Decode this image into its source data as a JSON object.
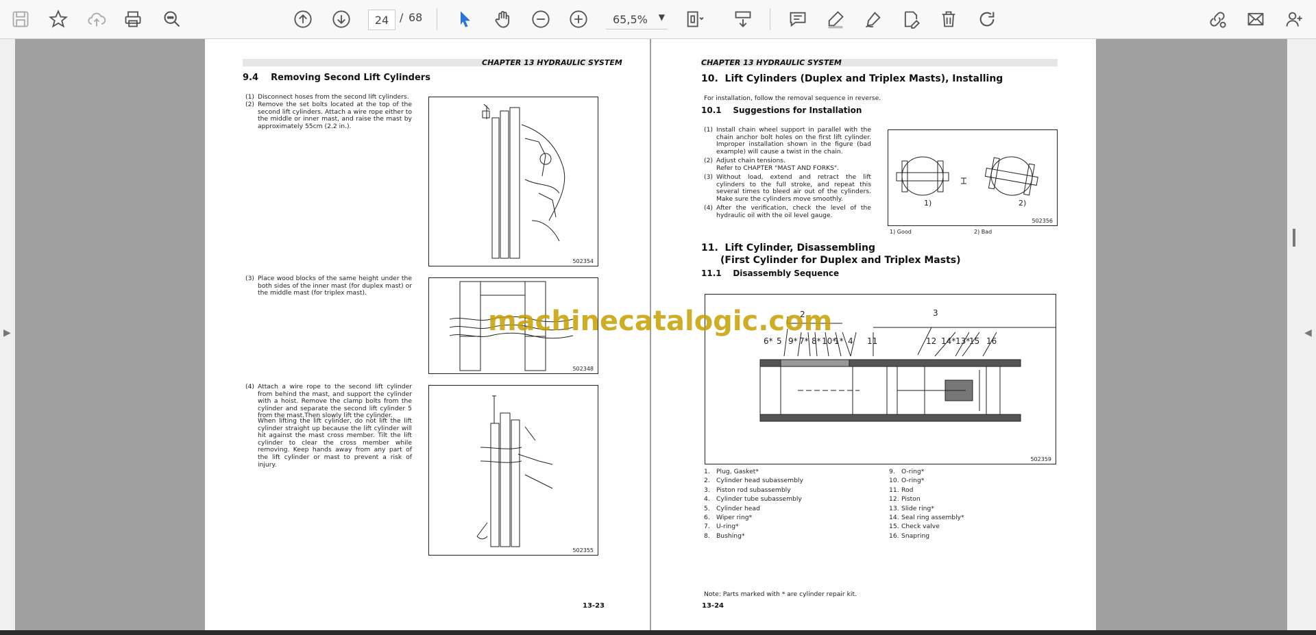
{
  "toolbar": {
    "page_current": "24",
    "page_separator": "/",
    "page_total": "68",
    "zoom": "65,5%"
  },
  "left_page": {
    "chapter": "CHAPTER 13 HYDRAULIC SYSTEM",
    "heading": "9.4    Removing Second Lift Cylinders",
    "step1_num": "(1)",
    "step1": "Disconnect hoses from the second lift cylinders.",
    "step2_num": "(2)",
    "step2": "Remove the set bolts located at the top of the second lift cylinders. Attach a wire rope either to the middle or inner mast, and raise the mast by approximately 55cm (2.2 in.).",
    "step3_num": "(3)",
    "step3": "Place wood blocks of the same height under the both sides of the inner mast (for duplex mast) or the middle mast (for triplex mast).",
    "step4_num": "(4)",
    "step4": "Attach a wire rope to the second lift cylinder from behind the mast, and support the cylinder with a hoist. Remove the clamp bolts from the cylinder and separate the second lift cylinder 5 from the mast.Then slowly lift the cylinder.",
    "step4b": "When lifting the lift cylinder, do not lift the lift cylinder straight up because the lift cylinder will hit against the mast cross member. Tilt the lift cylinder to clear the cross member while removing. Keep hands away from any part of the lift cylinder or mast to prevent a risk of injury.",
    "fig1_code": "502354",
    "fig2_code": "502348",
    "fig3_code": "502355",
    "page_number": "13-23"
  },
  "right_page": {
    "chapter": "CHAPTER 13 HYDRAULIC SYSTEM",
    "h10": "10.  Lift Cylinders (Duplex and Triplex Masts), Installing",
    "intro": "For installation, follow the removal sequence in reverse.",
    "h10_1": "10.1    Suggestions for Installation",
    "s1_num": "(1)",
    "s1": "Install chain wheel support in parallel with the chain anchor bolt holes on the first lift cylinder. Improper installation shown in the figure (bad example) will cause a twist in the chain.",
    "s2_num": "(2)",
    "s2": "Adjust chain tensions.",
    "s2b": "Refer to CHAPTER \"MAST AND FORKS\".",
    "s3_num": "(3)",
    "s3": "Without load, extend and retract the lift cylinders to the full stroke, and repeat this several times to bleed air out of the cylinders. Make sure the cylinders move smoothly.",
    "s4_num": "(4)",
    "s4": "After the verification, check the level of the hydraulic oil with the oil level gauge.",
    "fig_install_code": "502356",
    "fig_label_good": "1)",
    "fig_label_bad": "2)",
    "caption_good": "1) Good",
    "caption_bad": "2) Bad",
    "h11": "11.  Lift Cylinder, Disassembling",
    "h11b": "(First Cylinder for Duplex and Triplex Masts)",
    "h11_1": "11.1    Disassembly Sequence",
    "fig_dis_code": "502359",
    "callouts": [
      "6*",
      "5",
      "9*",
      "7*",
      "8*",
      "10*",
      "1*",
      "4",
      "11",
      "12",
      "14*",
      "13*",
      "15",
      "16"
    ],
    "callout_top2": "2",
    "callout_top3": "3",
    "parts_left": [
      {
        "n": "1.",
        "t": "Plug, Gasket*"
      },
      {
        "n": "2.",
        "t": "Cylinder head subassembly"
      },
      {
        "n": "3.",
        "t": "Piston rod subassembly"
      },
      {
        "n": "4.",
        "t": "Cylinder tube subassembly"
      },
      {
        "n": "5.",
        "t": "Cylinder head"
      },
      {
        "n": "6.",
        "t": "Wiper ring*"
      },
      {
        "n": "7.",
        "t": "U-ring*"
      },
      {
        "n": "8.",
        "t": "Bushing*"
      }
    ],
    "parts_right": [
      {
        "n": "9.",
        "t": "O-ring*"
      },
      {
        "n": "10.",
        "t": "O-ring*"
      },
      {
        "n": "11.",
        "t": "Rod"
      },
      {
        "n": "12.",
        "t": "Piston"
      },
      {
        "n": "13.",
        "t": "Slide ring*"
      },
      {
        "n": "14.",
        "t": "Seal ring assembly*"
      },
      {
        "n": "15.",
        "t": "Check valve"
      },
      {
        "n": "16.",
        "t": "Snapring"
      }
    ],
    "note": "Note: Parts marked with * are cylinder repair kit.",
    "page_number": "13-24"
  },
  "watermark": "machinecatalogic.com"
}
